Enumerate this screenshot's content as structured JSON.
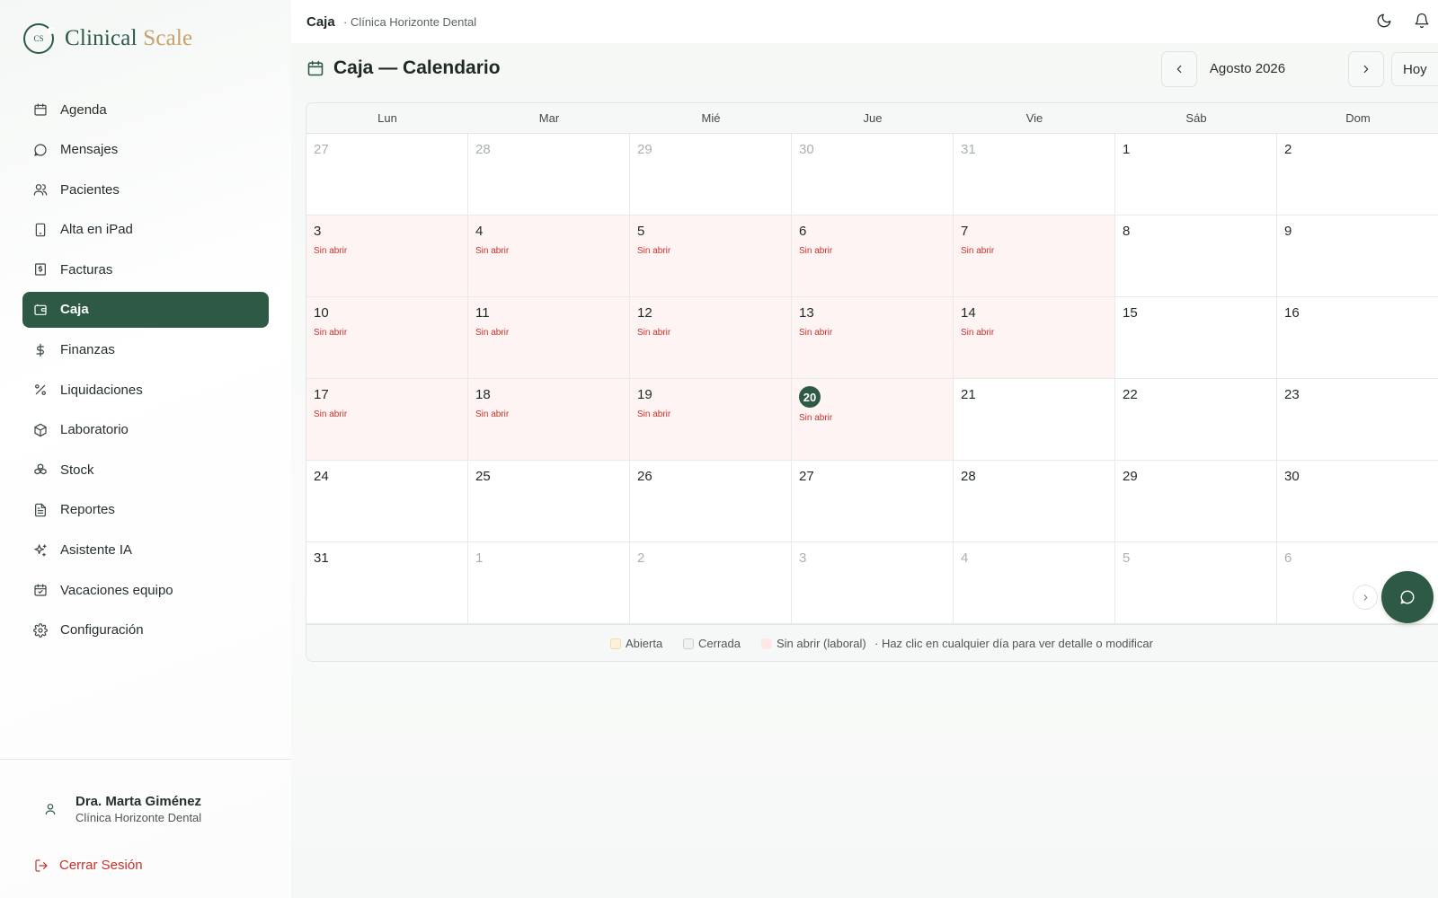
{
  "app": {
    "logo_text_primary": "Clinical",
    "logo_text_accent": "Scale",
    "logo_monogram": "CS"
  },
  "sidebar": {
    "items": [
      {
        "label": "Agenda",
        "icon": "calendar-icon"
      },
      {
        "label": "Mensajes",
        "icon": "message-circle-icon"
      },
      {
        "label": "Pacientes",
        "icon": "users-icon"
      },
      {
        "label": "Alta en iPad",
        "icon": "tablet-icon"
      },
      {
        "label": "Facturas",
        "icon": "receipt-icon"
      },
      {
        "label": "Caja",
        "icon": "wallet-icon",
        "active": true
      },
      {
        "label": "Finanzas",
        "icon": "dollar-icon"
      },
      {
        "label": "Liquidaciones",
        "icon": "percent-icon"
      },
      {
        "label": "Laboratorio",
        "icon": "package-icon"
      },
      {
        "label": "Stock",
        "icon": "boxes-icon"
      },
      {
        "label": "Reportes",
        "icon": "file-text-icon"
      },
      {
        "label": "Asistente IA",
        "icon": "sparkles-icon"
      },
      {
        "label": "Vacaciones equipo",
        "icon": "calendar-check-icon"
      },
      {
        "label": "Configuración",
        "icon": "gear-icon"
      }
    ],
    "user": {
      "name": "Dra. Marta Giménez",
      "clinic": "Clínica Horizonte Dental"
    },
    "logout_label": "Cerrar Sesión"
  },
  "header": {
    "breadcrumb": "Caja",
    "breadcrumb_sub": "· Clínica Horizonte Dental"
  },
  "page": {
    "title": "Caja — Calendario",
    "month_label": "Agosto 2026",
    "today_label": "Hoy"
  },
  "calendar": {
    "weekdays": [
      "Lun",
      "Mar",
      "Mié",
      "Jue",
      "Vie",
      "Sáb",
      "Dom"
    ],
    "status_unopened": "Sin abrir",
    "weeks": [
      [
        {
          "d": "27",
          "o": true
        },
        {
          "d": "28",
          "o": true
        },
        {
          "d": "29",
          "o": true
        },
        {
          "d": "30",
          "o": true
        },
        {
          "d": "31",
          "o": true
        },
        {
          "d": "1"
        },
        {
          "d": "2"
        }
      ],
      [
        {
          "d": "3",
          "s": 1
        },
        {
          "d": "4",
          "s": 1
        },
        {
          "d": "5",
          "s": 1
        },
        {
          "d": "6",
          "s": 1
        },
        {
          "d": "7",
          "s": 1
        },
        {
          "d": "8"
        },
        {
          "d": "9"
        }
      ],
      [
        {
          "d": "10",
          "s": 1
        },
        {
          "d": "11",
          "s": 1
        },
        {
          "d": "12",
          "s": 1
        },
        {
          "d": "13",
          "s": 1
        },
        {
          "d": "14",
          "s": 1
        },
        {
          "d": "15"
        },
        {
          "d": "16"
        }
      ],
      [
        {
          "d": "17",
          "s": 1
        },
        {
          "d": "18",
          "s": 1
        },
        {
          "d": "19",
          "s": 1
        },
        {
          "d": "20",
          "s": 1,
          "t": true
        },
        {
          "d": "21"
        },
        {
          "d": "22"
        },
        {
          "d": "23"
        }
      ],
      [
        {
          "d": "24"
        },
        {
          "d": "25"
        },
        {
          "d": "26"
        },
        {
          "d": "27"
        },
        {
          "d": "28"
        },
        {
          "d": "29"
        },
        {
          "d": "30"
        }
      ],
      [
        {
          "d": "31"
        },
        {
          "d": "1",
          "o": true
        },
        {
          "d": "2",
          "o": true
        },
        {
          "d": "3",
          "o": true
        },
        {
          "d": "4",
          "o": true
        },
        {
          "d": "5",
          "o": true
        },
        {
          "d": "6",
          "o": true
        }
      ]
    ]
  },
  "legend": {
    "open_label": "Abierta",
    "closed_label": "Cerrada",
    "unopened_label": "Sin abrir (laboral)",
    "hint": "· Haz clic en cualquier día para ver detalle o modificar"
  },
  "colors": {
    "brand": "#2e5a45",
    "accent_gold": "#c7a16a",
    "danger": "#c8322b",
    "unopened_bg": "#fdf4f3",
    "open_swatch": "#fdf1dc",
    "closed_swatch": "#eef2f0"
  }
}
